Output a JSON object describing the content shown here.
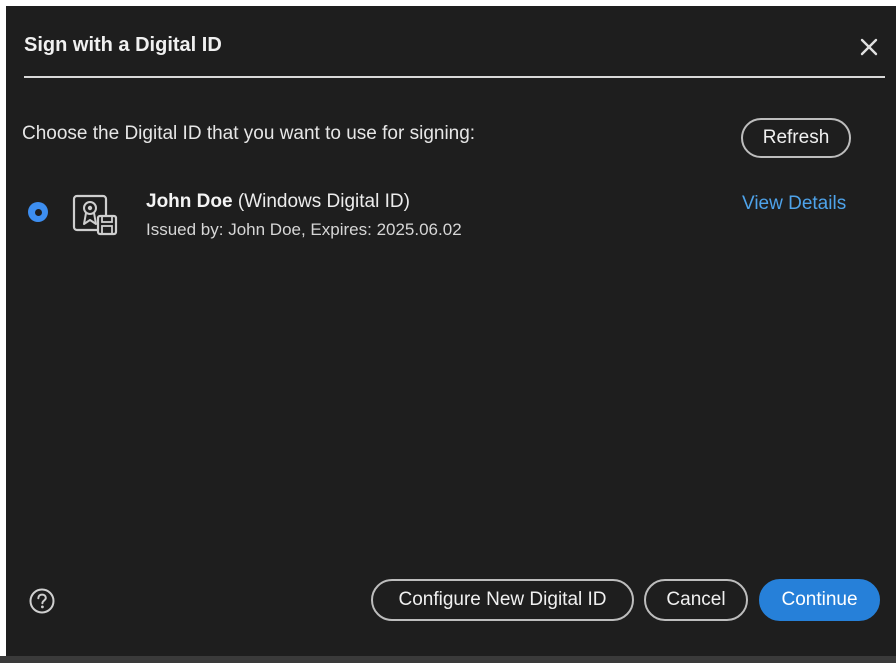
{
  "dialog": {
    "title": "Sign with a Digital ID",
    "close_icon": "close-icon"
  },
  "prompt": "Choose the Digital ID that you want to use for signing:",
  "refresh_label": "Refresh",
  "digital_ids": [
    {
      "selected": true,
      "icon": "certificate-icon",
      "name": "John Doe",
      "type": " (Windows Digital ID)",
      "issued": "Issued by: John Doe, Expires: 2025.06.02",
      "view_details_label": "View Details"
    }
  ],
  "footer": {
    "help_icon": "help-icon",
    "configure_label": "Configure New Digital ID",
    "cancel_label": "Cancel",
    "continue_label": "Continue"
  },
  "colors": {
    "background": "#1e1e1e",
    "accent": "#2680d9",
    "link": "#4ea3ea",
    "radio": "#3d8ef0"
  }
}
